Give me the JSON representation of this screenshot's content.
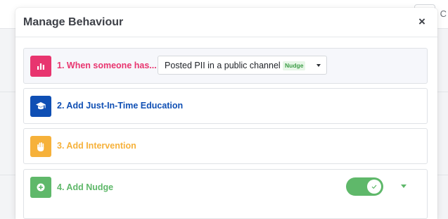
{
  "background": {
    "corner_text": "C"
  },
  "dialog": {
    "title": "Manage Behaviour",
    "close_label": "×"
  },
  "steps": [
    {
      "label": "1. When someone has...",
      "icon": "bar-chart-icon",
      "color": "#e8356f",
      "select": {
        "value": "Posted PII in a public channel",
        "badge": "Nudge"
      }
    },
    {
      "label": "2. Add Just-In-Time Education",
      "icon": "graduation-cap-icon",
      "color": "#0f4fb4"
    },
    {
      "label": "3. Add Intervention",
      "icon": "hand-icon",
      "color": "#f6b13a"
    },
    {
      "label": "4. Add Nudge",
      "icon": "plus-circle-icon",
      "color": "#5fb86a",
      "toggle_on": true
    }
  ]
}
